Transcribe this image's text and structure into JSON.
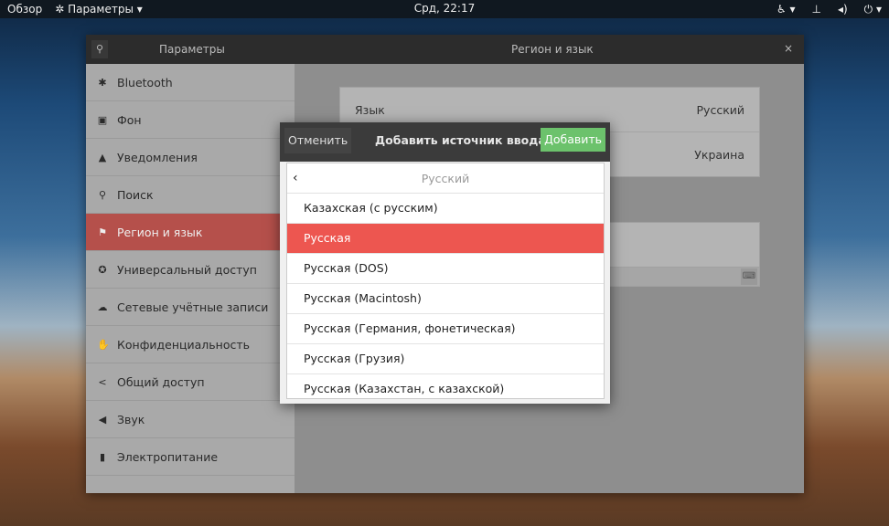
{
  "topbar": {
    "overview": "Обзор",
    "app_menu": "Параметры ▾",
    "clock": "Срд, 22:17"
  },
  "window": {
    "sidebar_title": "Параметры",
    "title": "Регион и язык",
    "close": "×"
  },
  "sidebar": {
    "items": [
      {
        "label": "Bluetooth",
        "icon": "✱"
      },
      {
        "label": "Фон",
        "icon": "▣"
      },
      {
        "label": "Уведомления",
        "icon": "▲"
      },
      {
        "label": "Поиск",
        "icon": "⚲"
      },
      {
        "label": "Регион и язык",
        "icon": "⚑"
      },
      {
        "label": "Универсальный доступ",
        "icon": "✪"
      },
      {
        "label": "Сетевые учётные записи",
        "icon": "☁"
      },
      {
        "label": "Конфиденциальность",
        "icon": "✋"
      },
      {
        "label": "Общий доступ",
        "icon": "<"
      },
      {
        "label": "Звук",
        "icon": "◀"
      },
      {
        "label": "Электропитание",
        "icon": "▮"
      }
    ]
  },
  "region": {
    "language_label": "Язык",
    "language_value": "Русский",
    "formats_value": "Украина"
  },
  "dialog": {
    "cancel": "Отменить",
    "title": "Добавить источник ввода",
    "add": "Добавить",
    "header": "Русский",
    "back": "‹",
    "items": [
      "Казахская (с русским)",
      "Русская",
      "Русская (DOS)",
      "Русская (Macintosh)",
      "Русская (Германия, фонетическая)",
      "Русская (Грузия)",
      "Русская (Казахстан, с казахской)"
    ]
  }
}
